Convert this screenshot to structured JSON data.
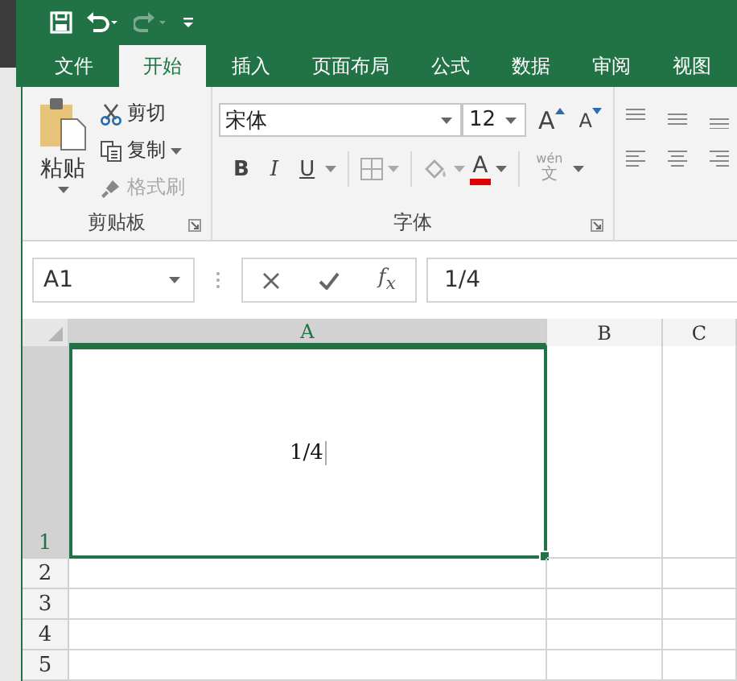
{
  "quick_access": {
    "undo": {
      "disabled": false
    },
    "redo": {
      "disabled": true
    }
  },
  "tabs": [
    {
      "label": "文件",
      "selected": false
    },
    {
      "label": "开始",
      "selected": true
    },
    {
      "label": "插入",
      "selected": false
    },
    {
      "label": "页面布局",
      "selected": false
    },
    {
      "label": "公式",
      "selected": false
    },
    {
      "label": "数据",
      "selected": false
    },
    {
      "label": "审阅",
      "selected": false
    },
    {
      "label": "视图",
      "selected": false
    }
  ],
  "clipboard": {
    "paste": "粘贴",
    "cut": {
      "label": "剪切",
      "disabled": false
    },
    "copy": {
      "label": "复制",
      "disabled": false
    },
    "format_painter": {
      "label": "格式刷",
      "disabled": true
    },
    "group_label": "剪贴板"
  },
  "font": {
    "font_name": "宋体",
    "font_size": "12",
    "grow": "A",
    "shrink": "A",
    "bold": "B",
    "italic": "I",
    "underline": "U",
    "font_color": "A",
    "phonetic_top": "wén",
    "phonetic_bottom": "文",
    "group_label": "字体"
  },
  "formula_bar": {
    "name_box": "A1",
    "insert_function": "f$_{x}$",
    "formula": "1/4"
  },
  "columns": [
    {
      "label": "A",
      "selected": true
    },
    {
      "label": "B",
      "selected": false
    },
    {
      "label": "C",
      "selected": false
    }
  ],
  "rows": [
    {
      "label": "1",
      "selected": true,
      "cells": [
        "1/4",
        "",
        ""
      ]
    },
    {
      "label": "2",
      "selected": false,
      "cells": [
        "",
        "",
        ""
      ]
    },
    {
      "label": "3",
      "selected": false,
      "cells": [
        "",
        "",
        ""
      ]
    },
    {
      "label": "4",
      "selected": false,
      "cells": [
        "",
        "",
        ""
      ]
    },
    {
      "label": "5",
      "selected": false,
      "cells": [
        "",
        "",
        ""
      ]
    }
  ]
}
